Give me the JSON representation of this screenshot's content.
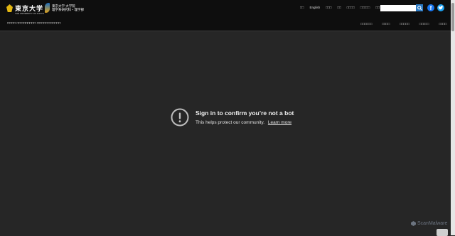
{
  "header": {
    "logo1_name": "東京大学",
    "logo1_sub": "THE UNIVERSITY OF TOKYO",
    "logo2_line1": "東京大学 大学院",
    "logo2_line2": "理学系研究科・理学部",
    "top_nav": [
      "□□",
      "English",
      "□□□",
      "□□",
      "□□□□",
      "□□□□□",
      "□□□□"
    ],
    "search_placeholder": "",
    "department_title": "□□□□ □□□□□□□□□ □□□□□□□□□□□",
    "main_nav": [
      "□□□□□□",
      "□□□□",
      "□□□□□",
      "□□□□□",
      "□□□□"
    ]
  },
  "notice": {
    "title": "Sign in to confirm you’re not a bot",
    "message": "This helps protect our community.",
    "learn_more": "Learn more"
  },
  "watermark": "ScanMalware",
  "colors": {
    "background": "#262626",
    "header": "#0e0e0e",
    "search_button": "#2b79c2",
    "facebook": "#1877f2",
    "twitter": "#1da1f2"
  },
  "icons": [
    "seal-logo-icon",
    "science-logo-icon",
    "search-icon",
    "facebook-icon",
    "twitter-icon",
    "alert-icon",
    "play-icon"
  ]
}
